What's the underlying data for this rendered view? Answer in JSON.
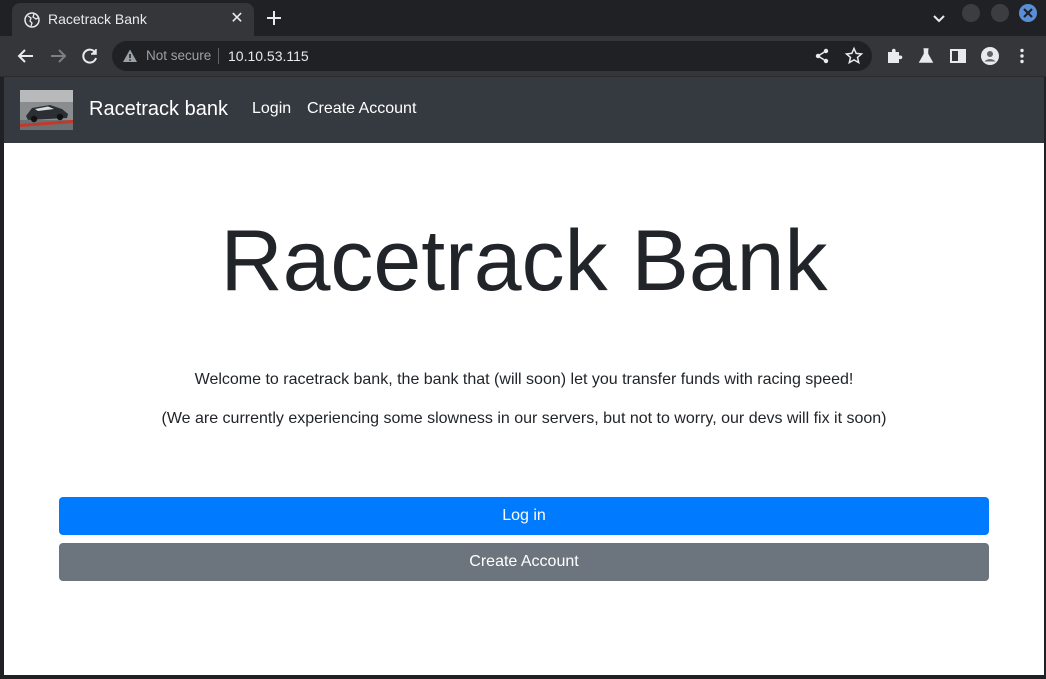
{
  "browser": {
    "tab_title": "Racetrack Bank",
    "close_glyph": "✕",
    "security_label": "Not secure",
    "url": "10.10.53.115"
  },
  "site": {
    "brand": "Racetrack bank",
    "nav": [
      {
        "label": "Login"
      },
      {
        "label": "Create Account"
      }
    ],
    "hero_title": "Racetrack Bank",
    "lead": [
      "Welcome to racetrack bank, the bank that (will soon) let you transfer funds with racing speed!",
      "(We are currently experiencing some slowness in our servers, but not to worry, our devs will fix it soon)"
    ],
    "buttons": {
      "login": "Log in",
      "create": "Create Account"
    }
  },
  "colors": {
    "navbar": "#343a40",
    "primary": "#007bff",
    "secondary": "#6c757d",
    "text": "#212529"
  }
}
